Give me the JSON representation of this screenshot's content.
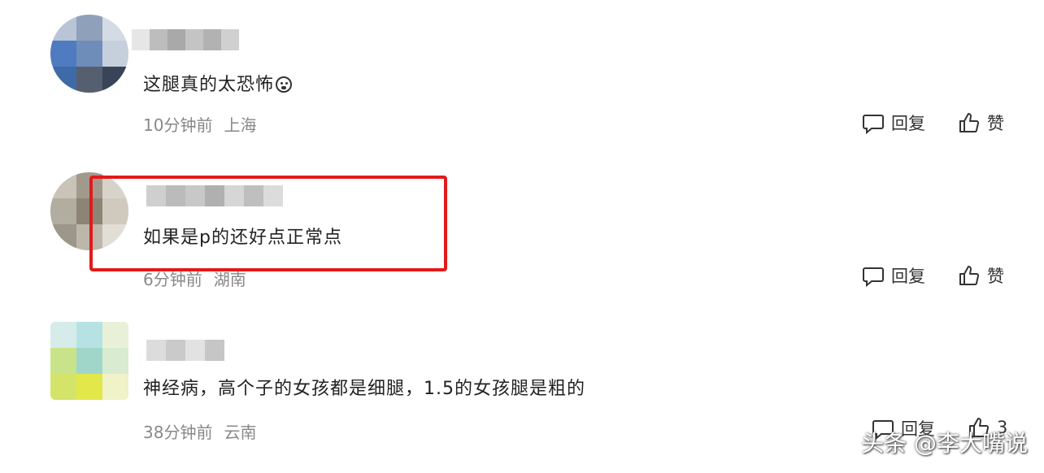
{
  "comments": [
    {
      "text": "这腿真的太恐怖",
      "time": "10分钟前",
      "location": "上海",
      "reply_label": "回复",
      "like_label": "赞"
    },
    {
      "text": "如果是p的还好点正常点",
      "time": "6分钟前",
      "location": "湖南",
      "reply_label": "回复",
      "like_label": "赞"
    },
    {
      "text": "神经病，高个子的女孩都是细腿，1.5的女孩腿是粗的",
      "time": "38分钟前",
      "location": "云南",
      "reply_label": "回复",
      "like_label": "3"
    }
  ],
  "watermark": "头条 @李大嘴说",
  "icons": {
    "reply": "comment-bubble-icon",
    "like": "thumbs-up-icon",
    "emoji": "grimace-emoji-icon"
  },
  "colors": {
    "highlight": "#e21a1a",
    "meta": "#888888"
  }
}
